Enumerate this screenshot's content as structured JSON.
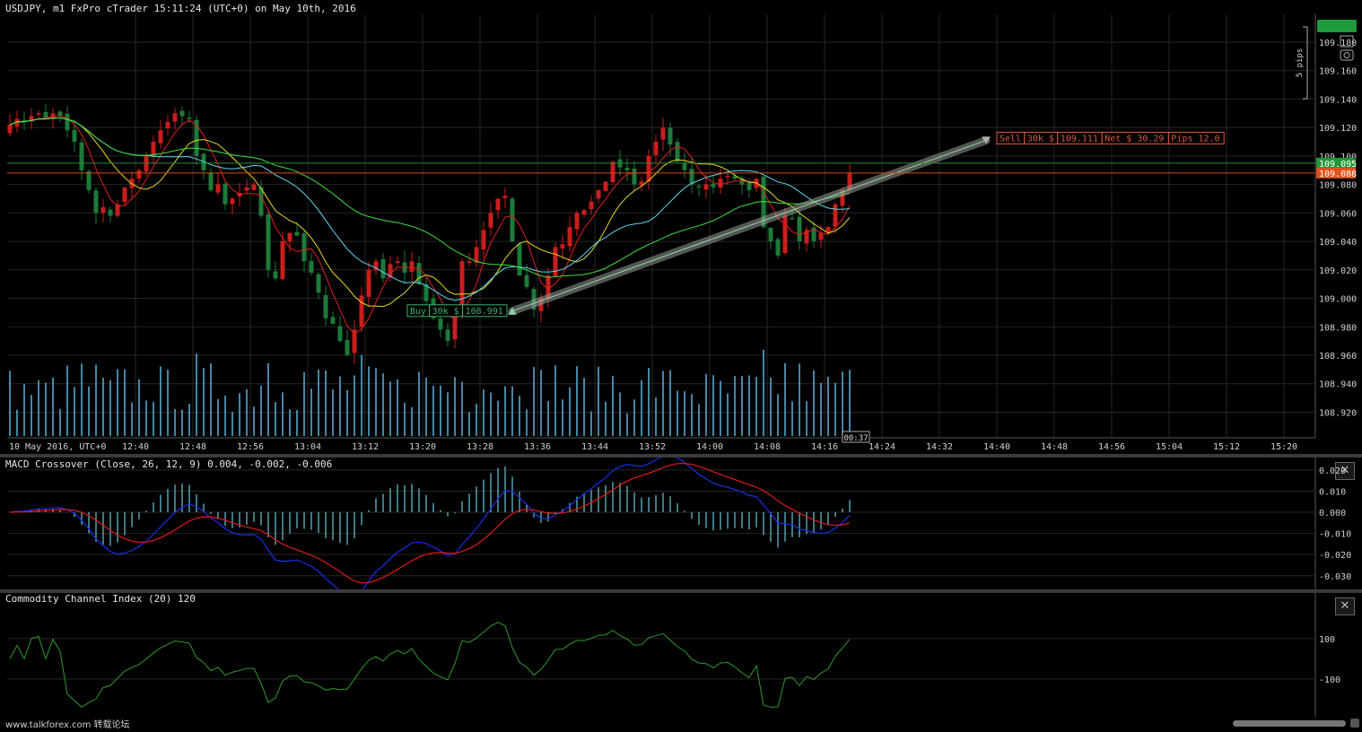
{
  "window": {
    "title": "USDJPY, m1 FxPro cTrader 15:11:24 (UTC+0) on May 10th, 2016",
    "watermark": "www.talkforex.com 转载论坛"
  },
  "colors": {
    "background": "#000000",
    "grid": "#262626",
    "bull": "#c81e1e",
    "bear": "#1d7a3a",
    "volume": "#5ab4dc",
    "macd_histogram": "#67c8d8",
    "macd_line": "#1a2ee8",
    "signal_line": "#e01a1a",
    "cci": "#2e9a2e",
    "bid_label": "#1f9a3a",
    "ask_label": "#e0521c"
  },
  "chart_data": [
    {
      "type": "candlestick",
      "symbol": "USDJPY",
      "timeframe": "m1",
      "x_labels": [
        "10 May 2016, UTC+0",
        "12:40",
        "12:48",
        "12:56",
        "13:04",
        "13:12",
        "13:20",
        "13:28",
        "13:36",
        "13:44",
        "13:52",
        "14:00",
        "14:08",
        "14:16",
        "14:24",
        "14:32",
        "14:40",
        "14:48",
        "14:56",
        "15:04",
        "15:12",
        "15:20"
      ],
      "y_ticks": [
        "109.180",
        "109.160",
        "109.140",
        "109.120",
        "109.100",
        "109.080",
        "109.060",
        "109.040",
        "109.020",
        "109.000",
        "108.980",
        "108.960",
        "108.940",
        "108.920"
      ],
      "ylim": [
        108.902,
        109.197
      ],
      "close_path": [
        109.122,
        109.126,
        109.124,
        109.128,
        109.13,
        109.126,
        109.13,
        109.128,
        109.118,
        109.11,
        109.09,
        109.076,
        109.06,
        109.064,
        109.058,
        109.066,
        109.078,
        109.084,
        109.09,
        109.1,
        109.11,
        109.118,
        109.124,
        109.13,
        109.128,
        109.126,
        109.1,
        109.09,
        109.076,
        109.08,
        109.066,
        109.07,
        109.074,
        109.078,
        109.08,
        109.058,
        109.02,
        109.014,
        109.04,
        109.046,
        109.044,
        109.026,
        109.018,
        109.004,
        108.986,
        108.982,
        108.97,
        108.96,
        108.978,
        109.002,
        109.02,
        109.026,
        109.014,
        109.024,
        109.026,
        109.018,
        109.026,
        109.01,
        108.998,
        108.986,
        108.978,
        108.97,
        108.992,
        109.026,
        109.026,
        109.036,
        109.048,
        109.06,
        109.07,
        109.072,
        109.04,
        109.016,
        109.008,
        108.992,
        109.0,
        109.016,
        109.036,
        109.038,
        109.05,
        109.06,
        109.062,
        109.068,
        109.076,
        109.082,
        109.096,
        109.092,
        109.09,
        109.08,
        109.082,
        109.1,
        109.11,
        109.12,
        109.108,
        109.096,
        109.09,
        109.08,
        109.078,
        109.08,
        109.078,
        109.084,
        109.086,
        109.084,
        109.08,
        109.076,
        109.084,
        109.05,
        109.04,
        109.03,
        109.058,
        109.056,
        109.04,
        109.048,
        109.04,
        109.046,
        109.05,
        109.066,
        109.076,
        109.088
      ],
      "bid_price_label": "109.095",
      "ask_price_label": "109.088",
      "pip_scale_label": "5 pips",
      "countdown": "00:37",
      "trade_buy": {
        "side": "Buy",
        "volume": "30k $",
        "price": "108.991"
      },
      "trade_sell": {
        "side": "Sell",
        "volume": "30k $",
        "price": "109.111",
        "net": "Net $ 30.29",
        "pips": "Pips 12.0"
      },
      "moving_averages": [
        {
          "period": 5,
          "color": "#e02020"
        },
        {
          "period": 10,
          "color": "#e8d820"
        },
        {
          "period": 20,
          "color": "#60d8f0"
        },
        {
          "period": 40,
          "color": "#40e040"
        }
      ],
      "volume": {
        "visible": true,
        "color": "#5ab4dc"
      },
      "grid": true
    },
    {
      "type": "line",
      "title": "MACD Crossover (Close, 26, 12, 9) 0.004, -0.002, -0.006",
      "y_ticks": [
        "0.020",
        "0.010",
        "0.000",
        "-0.010",
        "-0.020",
        "-0.030"
      ],
      "ylim": [
        -0.0335,
        0.0225
      ],
      "series": [
        {
          "name": "MACD",
          "color": "#1a2ee8"
        },
        {
          "name": "Signal",
          "color": "#e01a1a"
        },
        {
          "name": "Histogram",
          "color": "#67c8d8"
        }
      ]
    },
    {
      "type": "line",
      "title": "Commodity Channel Index (20) 120",
      "y_ticks": [
        "100",
        "-100"
      ],
      "ylim": [
        -270,
        300
      ],
      "series": [
        {
          "name": "CCI",
          "color": "#2e9a2e"
        }
      ]
    }
  ]
}
